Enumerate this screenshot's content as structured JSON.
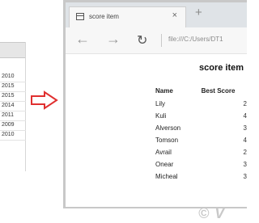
{
  "spreadsheet": {
    "years": [
      "2010",
      "2015",
      "2015",
      "2014",
      "2011",
      "2009",
      "2010"
    ]
  },
  "browser": {
    "tab_title": "score item",
    "close_glyph": "×",
    "new_tab_glyph": "+",
    "nav": {
      "back_glyph": "←",
      "forward_glyph": "→",
      "refresh_glyph": "↻"
    },
    "address": "file:///C:/Users/DT1"
  },
  "page": {
    "heading": "score item",
    "columns": [
      "Name",
      "Best Score"
    ],
    "rows": [
      {
        "name": "Lily",
        "score": "2"
      },
      {
        "name": "Kuli",
        "score": "4"
      },
      {
        "name": "Alverson",
        "score": "3"
      },
      {
        "name": "Tomson",
        "score": "4"
      },
      {
        "name": "Avrail",
        "score": "2"
      },
      {
        "name": "Onear",
        "score": "3"
      },
      {
        "name": "Micheal",
        "score": "3"
      }
    ]
  },
  "watermark": "© V",
  "colors": {
    "arrow": "#e03030",
    "tab_bar": "#dfe3e7"
  }
}
